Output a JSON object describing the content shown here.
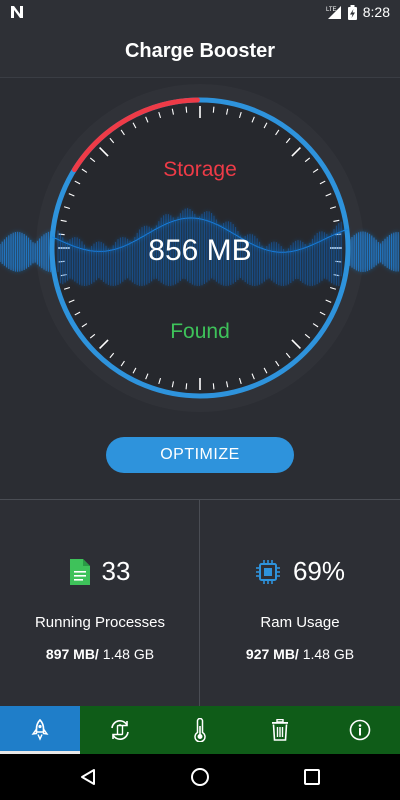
{
  "status_bar": {
    "time": "8:28",
    "network": "LTE"
  },
  "header": {
    "title": "Charge Booster"
  },
  "gauge": {
    "top_label": "Storage",
    "value": "856 MB",
    "bottom_label": "Found"
  },
  "actions": {
    "optimize_label": "OPTIMIZE"
  },
  "stats": [
    {
      "value": "33",
      "label": "Running Processes",
      "used": "897 MB/",
      "total": " 1.48 GB",
      "icon": "document-icon"
    },
    {
      "value": "69%",
      "label": "Ram Usage",
      "used": "927 MB/",
      "total": " 1.48 GB",
      "icon": "cpu-chip-icon"
    }
  ],
  "bottom_nav": [
    "rocket-icon",
    "battery-refresh-icon",
    "thermometer-icon",
    "trash-icon",
    "info-icon"
  ],
  "colors": {
    "accent_blue": "#2e93dc",
    "storage_red": "#ee3b47",
    "found_green": "#3ec25a",
    "nav_green": "#0f5c18",
    "nav_active": "#1f7ec9"
  }
}
